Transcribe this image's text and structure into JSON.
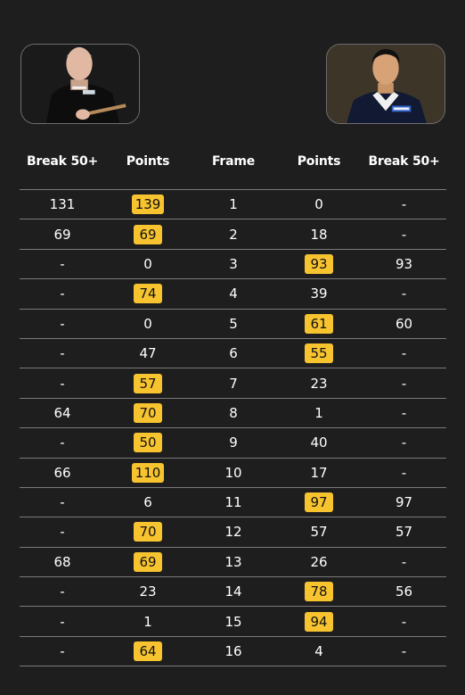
{
  "players": {
    "left": {
      "avatar": "player-one-photo"
    },
    "right": {
      "avatar": "player-two-photo"
    }
  },
  "colors": {
    "background": "#1e1e1e",
    "highlight": "#f7c430",
    "divider": "#7a7a7a"
  },
  "headers": [
    "Break 50+",
    "Points",
    "Frame",
    "Points",
    "Break 50+"
  ],
  "rows": [
    {
      "lb": "131",
      "lp": "139",
      "frame": "1",
      "rp": "0",
      "rb": "-",
      "winner": "left"
    },
    {
      "lb": "69",
      "lp": "69",
      "frame": "2",
      "rp": "18",
      "rb": "-",
      "winner": "left"
    },
    {
      "lb": "-",
      "lp": "0",
      "frame": "3",
      "rp": "93",
      "rb": "93",
      "winner": "right"
    },
    {
      "lb": "-",
      "lp": "74",
      "frame": "4",
      "rp": "39",
      "rb": "-",
      "winner": "left"
    },
    {
      "lb": "-",
      "lp": "0",
      "frame": "5",
      "rp": "61",
      "rb": "60",
      "winner": "right"
    },
    {
      "lb": "-",
      "lp": "47",
      "frame": "6",
      "rp": "55",
      "rb": "-",
      "winner": "right"
    },
    {
      "lb": "-",
      "lp": "57",
      "frame": "7",
      "rp": "23",
      "rb": "-",
      "winner": "left"
    },
    {
      "lb": "64",
      "lp": "70",
      "frame": "8",
      "rp": "1",
      "rb": "-",
      "winner": "left"
    },
    {
      "lb": "-",
      "lp": "50",
      "frame": "9",
      "rp": "40",
      "rb": "-",
      "winner": "left"
    },
    {
      "lb": "66",
      "lp": "110",
      "frame": "10",
      "rp": "17",
      "rb": "-",
      "winner": "left"
    },
    {
      "lb": "-",
      "lp": "6",
      "frame": "11",
      "rp": "97",
      "rb": "97",
      "winner": "right"
    },
    {
      "lb": "-",
      "lp": "70",
      "frame": "12",
      "rp": "57",
      "rb": "57",
      "winner": "left"
    },
    {
      "lb": "68",
      "lp": "69",
      "frame": "13",
      "rp": "26",
      "rb": "-",
      "winner": "left"
    },
    {
      "lb": "-",
      "lp": "23",
      "frame": "14",
      "rp": "78",
      "rb": "56",
      "winner": "right"
    },
    {
      "lb": "-",
      "lp": "1",
      "frame": "15",
      "rp": "94",
      "rb": "-",
      "winner": "right"
    },
    {
      "lb": "-",
      "lp": "64",
      "frame": "16",
      "rp": "4",
      "rb": "-",
      "winner": "left"
    }
  ]
}
